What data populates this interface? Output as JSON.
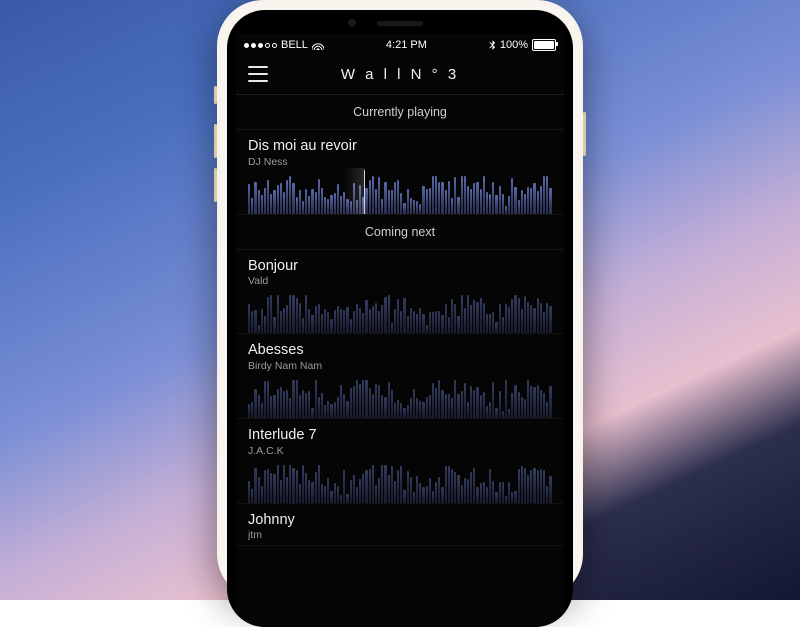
{
  "status": {
    "carrier": "BELL",
    "time": "4:21 PM",
    "battery_pct": "100%"
  },
  "header": {
    "title": "W a l l   N ° 3"
  },
  "sections": {
    "now": "Currently playing",
    "next": "Coming next"
  },
  "now_playing": {
    "title": "Dis moi au revoir",
    "artist": "DJ Ness"
  },
  "queue": [
    {
      "title": "Bonjour",
      "artist": "Vald"
    },
    {
      "title": "Abesses",
      "artist": "Birdy Nam Nam"
    },
    {
      "title": "Interlude 7",
      "artist": "J.A.C.K"
    },
    {
      "title": "Johnny",
      "artist": "jtm"
    }
  ]
}
